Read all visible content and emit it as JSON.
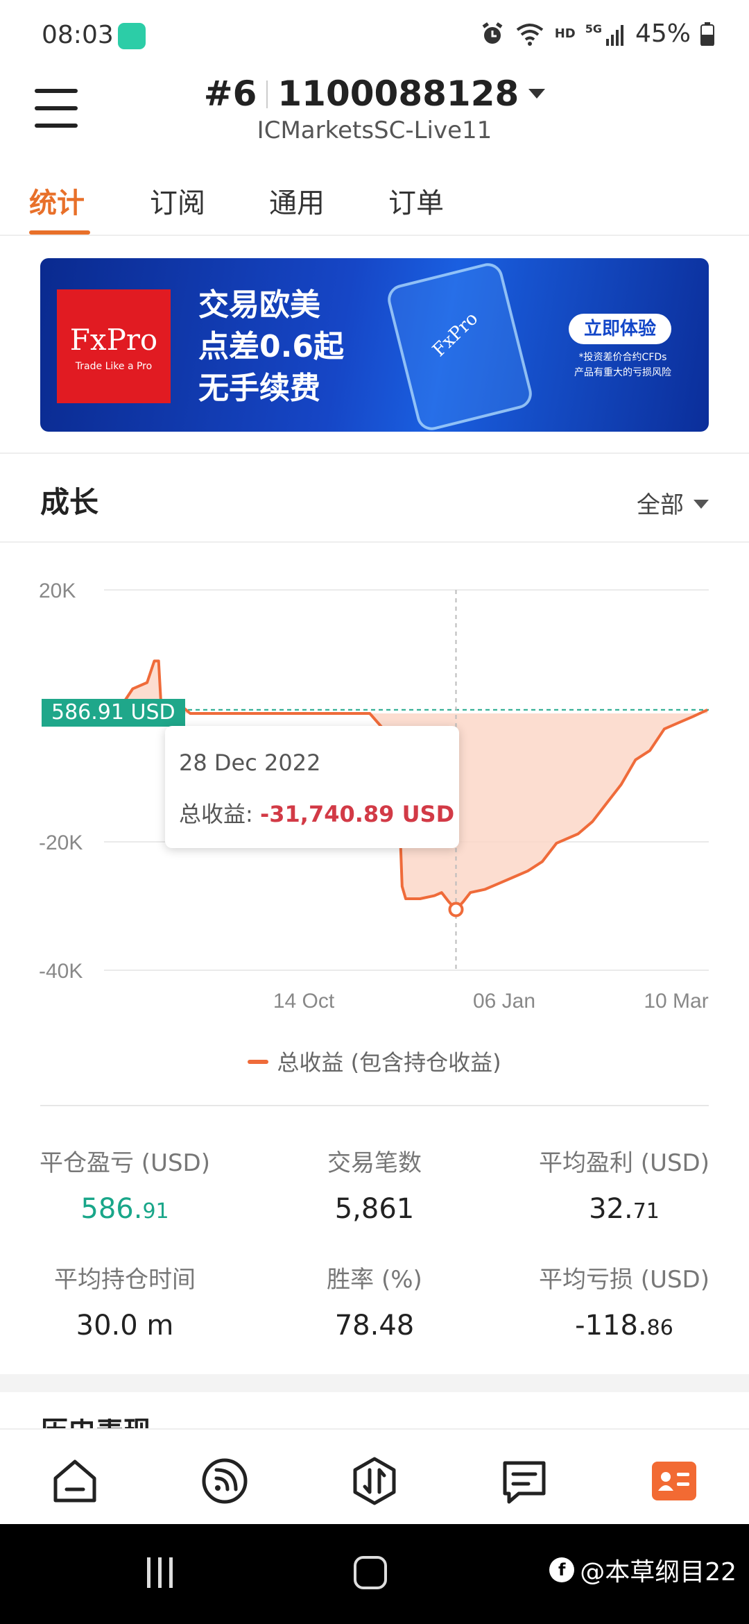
{
  "status_bar": {
    "time": "08:03",
    "network": "HD",
    "signal": "5G",
    "battery": "45%"
  },
  "header": {
    "account_no": "#6",
    "account_id": "1100088128",
    "server": "ICMarketsSC-Live11"
  },
  "tabs": [
    {
      "label": "统计",
      "active": true
    },
    {
      "label": "订阅",
      "active": false
    },
    {
      "label": "通用",
      "active": false
    },
    {
      "label": "订单",
      "active": false
    }
  ],
  "banner": {
    "logo_brand": "FxPro",
    "logo_slogan": "Trade Like a Pro",
    "line1": "交易欧美",
    "line2": "点差0.6起",
    "line3": "无手续费",
    "phone_label": "FxPro",
    "cta": "立即体验",
    "note1": "*投资差价合约CFDs",
    "note2": "产品有重大的亏损风险"
  },
  "growth": {
    "title": "成长",
    "filter": "全部"
  },
  "chart_data": {
    "type": "area",
    "y_ticks": [
      "20K",
      "-20K",
      "-40K"
    ],
    "x_ticks": [
      "14 Oct",
      "06 Jan",
      "10 Mar"
    ],
    "ylim": [
      -40000,
      20000
    ],
    "current_value_label": "586.91 USD",
    "current_value": 586.91,
    "legend": "总收益 (包含持仓收益)",
    "series_color": "#ef6b3a",
    "fill_color": "#fcd7c8",
    "badge_color": "#1fa78a",
    "tooltip": {
      "date": "28 Dec 2022",
      "label": "总收益:",
      "value": "-31,740.89 USD",
      "y": -31740.89
    },
    "series": [
      {
        "name": "总收益 (包含持仓收益)",
        "points": [
          [
            0,
            0
          ],
          [
            2,
            500
          ],
          [
            4,
            4000
          ],
          [
            6,
            5000
          ],
          [
            7,
            8500
          ],
          [
            7.6,
            8500
          ],
          [
            8,
            0
          ],
          [
            10,
            0
          ],
          [
            11,
            1000
          ],
          [
            12,
            0
          ],
          [
            20,
            0
          ],
          [
            30,
            0
          ],
          [
            37,
            0
          ],
          [
            40,
            -4000
          ],
          [
            41,
            -12000
          ],
          [
            41.5,
            -28000
          ],
          [
            42,
            -30000
          ],
          [
            44,
            -30000
          ],
          [
            46,
            -29500
          ],
          [
            47,
            -29000
          ],
          [
            48,
            -30500
          ],
          [
            49,
            -31740.89
          ],
          [
            50,
            -30500
          ],
          [
            51,
            -29000
          ],
          [
            53,
            -28500
          ],
          [
            55,
            -27500
          ],
          [
            57,
            -26500
          ],
          [
            59,
            -25500
          ],
          [
            61,
            -24000
          ],
          [
            63,
            -21000
          ],
          [
            66,
            -19500
          ],
          [
            68,
            -17500
          ],
          [
            70,
            -14500
          ],
          [
            72,
            -11500
          ],
          [
            74,
            -7500
          ],
          [
            76,
            -6000
          ],
          [
            78,
            -2500
          ],
          [
            80,
            -1500
          ],
          [
            82,
            -500
          ],
          [
            84,
            586.91
          ]
        ]
      }
    ]
  },
  "stats": [
    {
      "label": "平仓盈亏 (USD)",
      "int": "586.",
      "dec": "91",
      "highlight": true
    },
    {
      "label": "交易笔数",
      "int": "5,861",
      "dec": "",
      "highlight": false
    },
    {
      "label": "平均盈利 (USD)",
      "int": "32.",
      "dec": "71",
      "highlight": false
    },
    {
      "label": "平均持仓时间",
      "int": "30.0 m",
      "dec": "",
      "highlight": false
    },
    {
      "label": "胜率 (%)",
      "int": "78.48",
      "dec": "",
      "highlight": false
    },
    {
      "label": "平均亏损 (USD)",
      "int": "-118.",
      "dec": "86",
      "highlight": false
    }
  ],
  "next_section_peek": "历史表现",
  "bottom_nav": [
    {
      "icon": "home-icon",
      "active": false
    },
    {
      "icon": "signal-feed-icon",
      "active": false
    },
    {
      "icon": "trade-icon",
      "active": false
    },
    {
      "icon": "orders-icon",
      "active": false
    },
    {
      "icon": "account-card-icon",
      "active": true
    }
  ],
  "watermark": "@本草纲目22"
}
